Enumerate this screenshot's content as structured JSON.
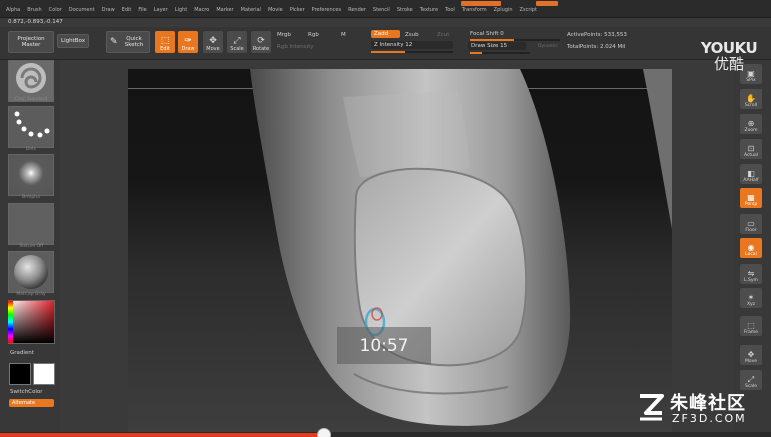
{
  "menu": {
    "items": [
      "Alpha",
      "Brush",
      "Color",
      "Document",
      "Draw",
      "Edit",
      "File",
      "Layer",
      "Light",
      "Macro",
      "Marker",
      "Material",
      "Movie",
      "Picker",
      "Preferences",
      "Render",
      "Stencil",
      "Stroke",
      "Texture",
      "Tool",
      "Transform",
      "Zplugin",
      "Zscript"
    ]
  },
  "status": {
    "coords": "0.872,-0.893,-0.147"
  },
  "shelf": {
    "projection_master": "Projection Master",
    "lightbox": "LightBox",
    "quick_sketch": "Quick Sketch",
    "edit": "Edit",
    "draw": "Draw",
    "move": "Move",
    "scale": "Scale",
    "rotate": "Rotate",
    "mrgb": "Mrgb",
    "rgb": "Rgb",
    "m": "M",
    "rgb_intensity": "Rgb Intensity",
    "zadd": "Zadd",
    "zsub": "Zsub",
    "zcut": "Zcut",
    "z_intensity": "Z Intensity 12",
    "focal_shift": "Focal Shift 0",
    "draw_size": "Draw Size 15",
    "dynamic": "Dynamic",
    "active_points": "ActivePoints: 533,553",
    "total_points": "TotalPoints: 2.024 Mil"
  },
  "left_tray": {
    "brush": "Clay_Standard",
    "stroke": "Dots",
    "alpha": "BrAlpha",
    "texture": "Texture Off",
    "material": "MatCap Gray",
    "gradient": "Gradient",
    "switch_color": "SwitchColor",
    "alternate": "Alternate"
  },
  "right_tray": {
    "items": [
      {
        "label": "SPix",
        "icon": "bpr-icon"
      },
      {
        "label": "Scroll",
        "icon": "scroll-icon"
      },
      {
        "label": "Zoom",
        "icon": "zoom-icon"
      },
      {
        "label": "Actual",
        "icon": "actual-icon"
      },
      {
        "label": "AAHalf",
        "icon": "aahalf-icon"
      },
      {
        "label": "Persp",
        "icon": "persp-icon"
      },
      {
        "label": "Floor",
        "icon": "floor-icon"
      },
      {
        "label": "Local",
        "icon": "local-icon"
      },
      {
        "label": "L.Sym",
        "icon": "lsym-icon"
      },
      {
        "label": "Xyz",
        "icon": "xyz-icon"
      },
      {
        "label": "Frame",
        "icon": "frame-icon"
      },
      {
        "label": "Move",
        "icon": "move-icon"
      },
      {
        "label": "Scale",
        "icon": "scale-icon"
      }
    ]
  },
  "overlay": {
    "timestamp": "10:57",
    "youku_en": "YOUKU",
    "youku_cn": "优酷",
    "zf_cn": "朱峰社区",
    "zf_url": "ZF3D.COM"
  },
  "video": {
    "progress_percent": 42
  },
  "colors": {
    "accent": "#e8771f",
    "progress": "#e23b1d"
  }
}
